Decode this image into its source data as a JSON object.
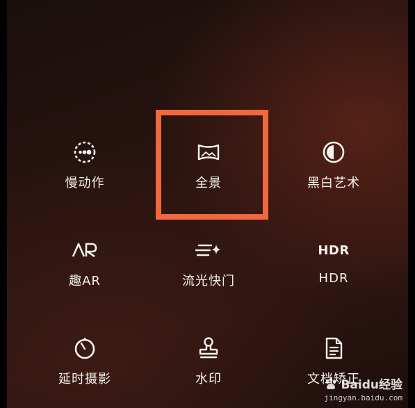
{
  "modes": [
    {
      "label": "慢动作",
      "icon": "slow-motion-icon"
    },
    {
      "label": "全景",
      "icon": "panorama-icon"
    },
    {
      "label": "黑白艺术",
      "icon": "monochrome-icon"
    },
    {
      "label": "趣AR",
      "icon": "ar-icon",
      "icon_text": "AR"
    },
    {
      "label": "流光快门",
      "icon": "light-painting-icon"
    },
    {
      "label": "HDR",
      "icon": "hdr-icon",
      "icon_text": "HDR"
    },
    {
      "label": "延时摄影",
      "icon": "time-lapse-icon"
    },
    {
      "label": "水印",
      "icon": "watermark-stamp-icon"
    },
    {
      "label": "文档矫正",
      "icon": "document-icon"
    }
  ],
  "highlight": {
    "target": "全景",
    "color": "#f0683c"
  },
  "watermark": {
    "brand": "Baidu经验",
    "url": "jingyan.baidu.com"
  }
}
